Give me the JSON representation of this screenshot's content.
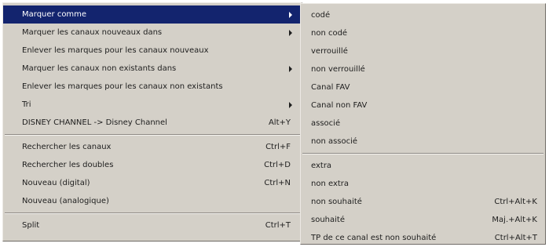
{
  "main_menu": {
    "items": [
      {
        "label": "Marquer comme",
        "shortcut": "",
        "submenu": true,
        "selected": true
      },
      {
        "label": "Marquer les canaux nouveaux dans",
        "shortcut": "",
        "submenu": true
      },
      {
        "label": "Enlever les marques pour les canaux nouveaux",
        "shortcut": "",
        "submenu": false
      },
      {
        "label": "Marquer les canaux non existants dans",
        "shortcut": "",
        "submenu": true
      },
      {
        "label": "Enlever les marques pour les canaux non existants",
        "shortcut": "",
        "submenu": false
      },
      {
        "label": "Tri",
        "shortcut": "",
        "submenu": true
      },
      {
        "label": "DISNEY CHANNEL -> Disney Channel",
        "shortcut": "Alt+Y",
        "submenu": false
      },
      {
        "label": "Rechercher les canaux",
        "shortcut": "Ctrl+F",
        "submenu": false
      },
      {
        "label": "Rechercher les doubles",
        "shortcut": "Ctrl+D",
        "submenu": false
      },
      {
        "label": "Nouveau (digital)",
        "shortcut": "Ctrl+N",
        "submenu": false
      },
      {
        "label": "Nouveau (analogique)",
        "shortcut": "",
        "submenu": false
      },
      {
        "label": "Split",
        "shortcut": "Ctrl+T",
        "submenu": false
      }
    ]
  },
  "sub_menu": {
    "items": [
      {
        "label": "codé",
        "shortcut": ""
      },
      {
        "label": "non codé",
        "shortcut": ""
      },
      {
        "label": "verrouillé",
        "shortcut": ""
      },
      {
        "label": "non verrouillé",
        "shortcut": ""
      },
      {
        "label": "Canal FAV",
        "shortcut": ""
      },
      {
        "label": "Canal non FAV",
        "shortcut": ""
      },
      {
        "label": "associé",
        "shortcut": ""
      },
      {
        "label": "non associé",
        "shortcut": ""
      },
      {
        "label": "extra",
        "shortcut": ""
      },
      {
        "label": "non extra",
        "shortcut": ""
      },
      {
        "label": "non souhaité",
        "shortcut": "Ctrl+Alt+K"
      },
      {
        "label": "souhaité",
        "shortcut": "Maj.+Alt+K"
      },
      {
        "label": "TP de ce canal est non souhaité",
        "shortcut": "Ctrl+Alt+T"
      }
    ]
  },
  "colors": {
    "menu_bg": "#d4d0c8",
    "highlight_bg": "#13246e",
    "highlight_text": "#ffffff",
    "text": "#1e1e1e"
  }
}
